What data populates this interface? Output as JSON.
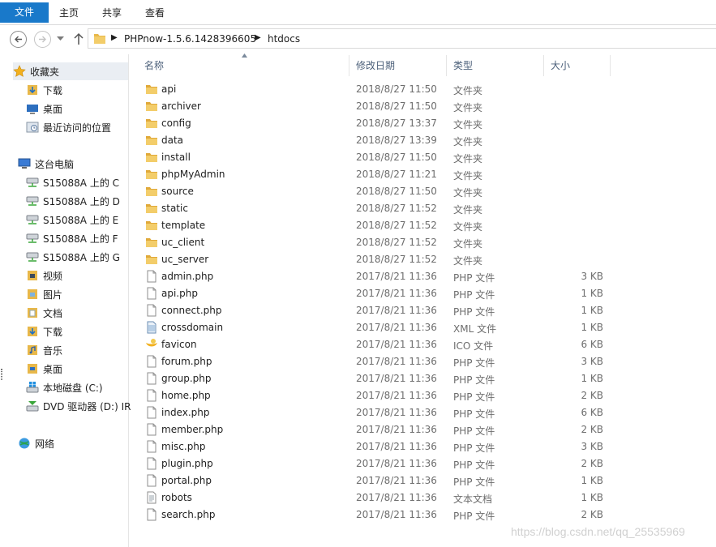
{
  "ribbon": {
    "tabs": [
      "文件",
      "主页",
      "共享",
      "查看"
    ]
  },
  "address": {
    "crumbs": [
      "PHPnow-1.5.6.1428396605",
      "htdocs"
    ],
    "separator": "▶"
  },
  "nav": {
    "favorites_label": "收藏夹",
    "favorites": [
      "下载",
      "桌面",
      "最近访问的位置"
    ],
    "thispc_label": "这台电脑",
    "drives": [
      "S15088A 上的 C",
      "S15088A 上的 D",
      "S15088A 上的 E",
      "S15088A 上的 F",
      "S15088A 上的 G"
    ],
    "libraries": [
      "视频",
      "图片",
      "文档",
      "下载",
      "音乐",
      "桌面"
    ],
    "local_disk": "本地磁盘 (C:)",
    "dvd": "DVD 驱动器 (D:) IR",
    "network": "网络"
  },
  "columns": {
    "name": "名称",
    "date": "修改日期",
    "type": "类型",
    "size": "大小"
  },
  "files": [
    {
      "name": "api",
      "date": "2018/8/27 11:50",
      "type": "文件夹",
      "size": "",
      "icon": "folder-icon"
    },
    {
      "name": "archiver",
      "date": "2018/8/27 11:50",
      "type": "文件夹",
      "size": "",
      "icon": "folder-icon"
    },
    {
      "name": "config",
      "date": "2018/8/27 13:37",
      "type": "文件夹",
      "size": "",
      "icon": "folder-icon"
    },
    {
      "name": "data",
      "date": "2018/8/27 13:39",
      "type": "文件夹",
      "size": "",
      "icon": "folder-icon"
    },
    {
      "name": "install",
      "date": "2018/8/27 11:50",
      "type": "文件夹",
      "size": "",
      "icon": "folder-icon"
    },
    {
      "name": "phpMyAdmin",
      "date": "2018/8/27 11:21",
      "type": "文件夹",
      "size": "",
      "icon": "folder-icon"
    },
    {
      "name": "source",
      "date": "2018/8/27 11:50",
      "type": "文件夹",
      "size": "",
      "icon": "folder-icon"
    },
    {
      "name": "static",
      "date": "2018/8/27 11:52",
      "type": "文件夹",
      "size": "",
      "icon": "folder-icon"
    },
    {
      "name": "template",
      "date": "2018/8/27 11:52",
      "type": "文件夹",
      "size": "",
      "icon": "folder-icon"
    },
    {
      "name": "uc_client",
      "date": "2018/8/27 11:52",
      "type": "文件夹",
      "size": "",
      "icon": "folder-icon"
    },
    {
      "name": "uc_server",
      "date": "2018/8/27 11:52",
      "type": "文件夹",
      "size": "",
      "icon": "folder-icon"
    },
    {
      "name": "admin.php",
      "date": "2017/8/21 11:36",
      "type": "PHP 文件",
      "size": "3 KB",
      "icon": "php-file-icon"
    },
    {
      "name": "api.php",
      "date": "2017/8/21 11:36",
      "type": "PHP 文件",
      "size": "1 KB",
      "icon": "php-file-icon"
    },
    {
      "name": "connect.php",
      "date": "2017/8/21 11:36",
      "type": "PHP 文件",
      "size": "1 KB",
      "icon": "php-file-icon"
    },
    {
      "name": "crossdomain",
      "date": "2017/8/21 11:36",
      "type": "XML 文件",
      "size": "1 KB",
      "icon": "xml-file-icon"
    },
    {
      "name": "favicon",
      "date": "2017/8/21 11:36",
      "type": "ICO 文件",
      "size": "6 KB",
      "icon": "ico-file-icon"
    },
    {
      "name": "forum.php",
      "date": "2017/8/21 11:36",
      "type": "PHP 文件",
      "size": "3 KB",
      "icon": "php-file-icon"
    },
    {
      "name": "group.php",
      "date": "2017/8/21 11:36",
      "type": "PHP 文件",
      "size": "1 KB",
      "icon": "php-file-icon"
    },
    {
      "name": "home.php",
      "date": "2017/8/21 11:36",
      "type": "PHP 文件",
      "size": "2 KB",
      "icon": "php-file-icon"
    },
    {
      "name": "index.php",
      "date": "2017/8/21 11:36",
      "type": "PHP 文件",
      "size": "6 KB",
      "icon": "php-file-icon"
    },
    {
      "name": "member.php",
      "date": "2017/8/21 11:36",
      "type": "PHP 文件",
      "size": "2 KB",
      "icon": "php-file-icon"
    },
    {
      "name": "misc.php",
      "date": "2017/8/21 11:36",
      "type": "PHP 文件",
      "size": "3 KB",
      "icon": "php-file-icon"
    },
    {
      "name": "plugin.php",
      "date": "2017/8/21 11:36",
      "type": "PHP 文件",
      "size": "2 KB",
      "icon": "php-file-icon"
    },
    {
      "name": "portal.php",
      "date": "2017/8/21 11:36",
      "type": "PHP 文件",
      "size": "1 KB",
      "icon": "php-file-icon"
    },
    {
      "name": "robots",
      "date": "2017/8/21 11:36",
      "type": "文本文档",
      "size": "1 KB",
      "icon": "text-file-icon"
    },
    {
      "name": "search.php",
      "date": "2017/8/21 11:36",
      "type": "PHP 文件",
      "size": "2 KB",
      "icon": "php-file-icon"
    }
  ],
  "watermark": "https://blog.csdn.net/qq_25535969",
  "colors": {
    "file_tab": "#1979ca",
    "folder": "#e8b84a",
    "header_text": "#4c607a",
    "meta_text": "#6d6d6d"
  }
}
